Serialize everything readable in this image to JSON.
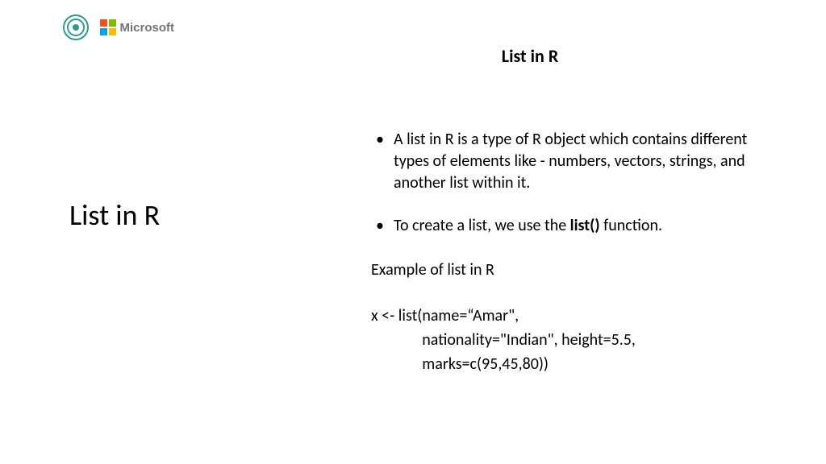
{
  "header": {
    "company_text": "Microsoft"
  },
  "title_top": "List in R",
  "left_heading": "List in R",
  "bullets": [
    {
      "pre": "A list in R is a type of R object which contains different types of elements like - numbers, vectors, strings, and another list within it."
    },
    {
      "pre": "To create a list, we use the ",
      "bold": "list()",
      "post": " function."
    }
  ],
  "example_heading": "Example of list in R",
  "code_line1": "x <- list(name=“Amar\",",
  "code_line2": "              nationality=\"Indian\", height=5.5,",
  "code_line3": "              marks=c(95,45,80))"
}
